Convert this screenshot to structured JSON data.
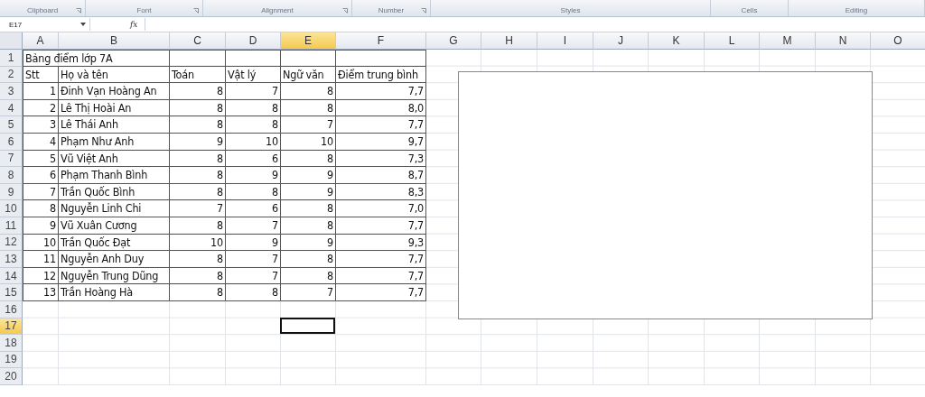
{
  "ribbon": {
    "groups": [
      {
        "label": "Clipboard",
        "launcher": true
      },
      {
        "label": "Font",
        "launcher": true
      },
      {
        "label": "Alignment",
        "launcher": true
      },
      {
        "label": "Number",
        "launcher": true
      },
      {
        "label": "Styles",
        "launcher": false
      },
      {
        "label": "Cells",
        "launcher": false
      },
      {
        "label": "Editing",
        "launcher": false
      }
    ]
  },
  "formula_bar": {
    "name_box": "E17",
    "function_label": "fx"
  },
  "columns": [
    {
      "label": "A",
      "selected": false
    },
    {
      "label": "B",
      "selected": false
    },
    {
      "label": "C",
      "selected": false
    },
    {
      "label": "D",
      "selected": false
    },
    {
      "label": "E",
      "selected": true
    },
    {
      "label": "F",
      "selected": false
    },
    {
      "label": "G",
      "selected": false
    },
    {
      "label": "H",
      "selected": false
    },
    {
      "label": "I",
      "selected": false
    },
    {
      "label": "J",
      "selected": false
    },
    {
      "label": "K",
      "selected": false
    },
    {
      "label": "L",
      "selected": false
    },
    {
      "label": "M",
      "selected": false
    },
    {
      "label": "N",
      "selected": false
    },
    {
      "label": "O",
      "selected": false
    }
  ],
  "rows": [
    {
      "header": "1",
      "selected": false,
      "kind": "title",
      "cells": [
        "Bảng điểm lớp 7A"
      ]
    },
    {
      "header": "2",
      "selected": false,
      "kind": "header",
      "cells": [
        "Stt",
        "Họ và tên",
        "Toán",
        "Vật lý",
        "Ngữ văn",
        "Điểm trung bình"
      ]
    },
    {
      "header": "3",
      "selected": false,
      "kind": "data",
      "cells": [
        "1",
        "Đinh Vạn Hoàng An",
        "8",
        "7",
        "8",
        "7,7"
      ]
    },
    {
      "header": "4",
      "selected": false,
      "kind": "data",
      "cells": [
        "2",
        "Lê Thị Hoài An",
        "8",
        "8",
        "8",
        "8,0"
      ]
    },
    {
      "header": "5",
      "selected": false,
      "kind": "data",
      "cells": [
        "3",
        "Lê Thái Anh",
        "8",
        "8",
        "7",
        "7,7"
      ]
    },
    {
      "header": "6",
      "selected": false,
      "kind": "data",
      "cells": [
        "4",
        "Phạm Như Anh",
        "9",
        "10",
        "10",
        "9,7"
      ]
    },
    {
      "header": "7",
      "selected": false,
      "kind": "data",
      "cells": [
        "5",
        "Vũ Việt Anh",
        "8",
        "6",
        "8",
        "7,3"
      ]
    },
    {
      "header": "8",
      "selected": false,
      "kind": "data",
      "cells": [
        "6",
        "Phạm Thanh Bình",
        "8",
        "9",
        "9",
        "8,7"
      ]
    },
    {
      "header": "9",
      "selected": false,
      "kind": "data",
      "cells": [
        "7",
        "Trần Quốc Bình",
        "8",
        "8",
        "9",
        "8,3"
      ]
    },
    {
      "header": "10",
      "selected": false,
      "kind": "data",
      "cells": [
        "8",
        "Nguyễn Linh Chi",
        "7",
        "6",
        "8",
        "7,0"
      ]
    },
    {
      "header": "11",
      "selected": false,
      "kind": "data",
      "cells": [
        "9",
        "Vũ Xuân Cương",
        "8",
        "7",
        "8",
        "7,7"
      ]
    },
    {
      "header": "12",
      "selected": false,
      "kind": "data",
      "cells": [
        "10",
        "Trần Quốc Đạt",
        "10",
        "9",
        "9",
        "9,3"
      ]
    },
    {
      "header": "13",
      "selected": false,
      "kind": "data",
      "cells": [
        "11",
        "Nguyễn Anh Duy",
        "8",
        "7",
        "8",
        "7,7"
      ]
    },
    {
      "header": "14",
      "selected": false,
      "kind": "data",
      "cells": [
        "12",
        "Nguyễn Trung Dũng",
        "8",
        "7",
        "8",
        "7,7"
      ]
    },
    {
      "header": "15",
      "selected": false,
      "kind": "data",
      "cells": [
        "13",
        "Trần Hoàng Hà",
        "8",
        "8",
        "7",
        "7,7"
      ]
    },
    {
      "header": "16",
      "selected": false,
      "kind": "empty"
    },
    {
      "header": "17",
      "selected": true,
      "kind": "empty"
    },
    {
      "header": "18",
      "selected": false,
      "kind": "empty"
    },
    {
      "header": "19",
      "selected": false,
      "kind": "empty"
    },
    {
      "header": "20",
      "selected": false,
      "kind": "empty"
    }
  ]
}
